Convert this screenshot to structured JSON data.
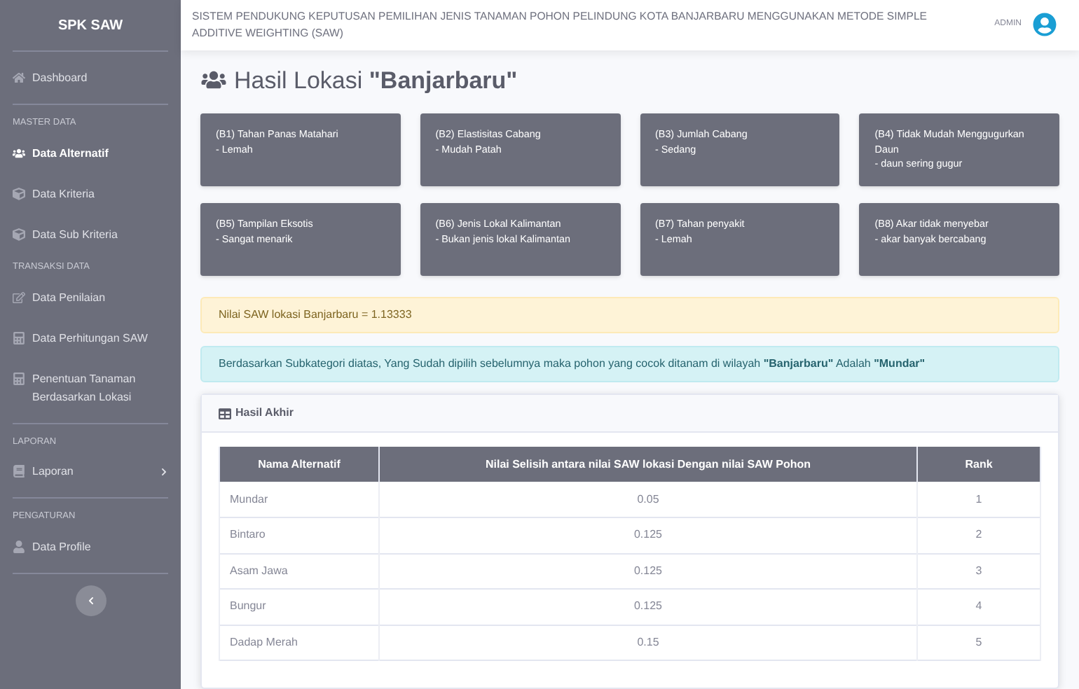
{
  "sidebar": {
    "brand": "SPK SAW",
    "items": [
      {
        "kind": "link",
        "label": "Dashboard",
        "selected": false
      },
      {
        "kind": "divider"
      },
      {
        "kind": "heading",
        "label": "MASTER DATA"
      },
      {
        "kind": "link",
        "label": "Data Alternatif",
        "selected": true
      },
      {
        "kind": "link",
        "label": "Data Kriteria",
        "selected": false
      },
      {
        "kind": "link",
        "label": "Data Sub Kriteria",
        "selected": false
      },
      {
        "kind": "heading",
        "label": "TRANSAKSI DATA"
      },
      {
        "kind": "link",
        "label": "Data Penilaian",
        "selected": false
      },
      {
        "kind": "link",
        "label": "Data Perhitungan SAW",
        "selected": false
      },
      {
        "kind": "link",
        "label": "Penentuan Tanaman Berdasarkan Lokasi",
        "selected": false
      },
      {
        "kind": "divider"
      },
      {
        "kind": "heading",
        "label": "LAPORAN"
      },
      {
        "kind": "group",
        "label": "Laporan",
        "expanded": false
      },
      {
        "kind": "divider"
      },
      {
        "kind": "heading",
        "label": "PENGATURAN"
      },
      {
        "kind": "link",
        "label": "Data Profile",
        "selected": false
      },
      {
        "kind": "divider"
      }
    ]
  },
  "topbar": {
    "title": "SISTEM PENDUKUNG KEPUTUSAN PEMILIHAN JENIS TANAMAN POHON PELINDUNG KOTA BANJARBARU MENGGUNAKAN METODE SIMPLE ADDITIVE WEIGHTING (SAW)",
    "user": "ADMIN"
  },
  "page_title": "Hasil Lokasi **\"Banjarbaru\"**",
  "criteria_cards": [
    {
      "title": "(B1) Tahan Panas Matahari",
      "value": "- Lemah"
    },
    {
      "title": "(B2) Elastisitas Cabang",
      "value": "- Mudah Patah"
    },
    {
      "title": "(B3) Jumlah Cabang",
      "value": "- Sedang"
    },
    {
      "title": "(B4) Tidak Mudah Menggugurkan Daun",
      "value": "- daun sering gugur"
    },
    {
      "title": "(B5) Tampilan Eksotis",
      "value": "- Sangat menarik"
    },
    {
      "title": "(B6) Jenis Lokal Kalimantan",
      "value": "- Bukan jenis lokal Kalimantan"
    },
    {
      "title": "(B7) Tahan penyakit",
      "value": "- Lemah"
    },
    {
      "title": "(B8) Akar tidak menyebar",
      "value": "- akar banyak bercabang"
    }
  ],
  "alerts": [
    {
      "kind": "warning",
      "text": "Nilai SAW lokasi Banjarbaru = 1.13333"
    },
    {
      "kind": "info",
      "text": "Berdasarkan Subkategori diatas, Yang Sudah dipilih sebelumnya maka pohon yang cocok ditanam di wilayah **\"Banjarbaru\"** Adalah **\"Mundar\"**"
    }
  ],
  "result_card": {
    "title": "Hasil Akhir",
    "table": {
      "columns": [
        "Nama Alternatif",
        "Nilai Selisih antara nilai SAW lokasi Dengan nilai SAW Pohon",
        "Rank"
      ],
      "rows": [
        [
          "Mundar",
          "0.05",
          "1"
        ],
        [
          "Bintaro",
          "0.125",
          "2"
        ],
        [
          "Asam Jawa",
          "0.125",
          "3"
        ],
        [
          "Bungur",
          "0.125",
          "4"
        ],
        [
          "Dadap Merah",
          "0.15",
          "5"
        ]
      ]
    }
  }
}
